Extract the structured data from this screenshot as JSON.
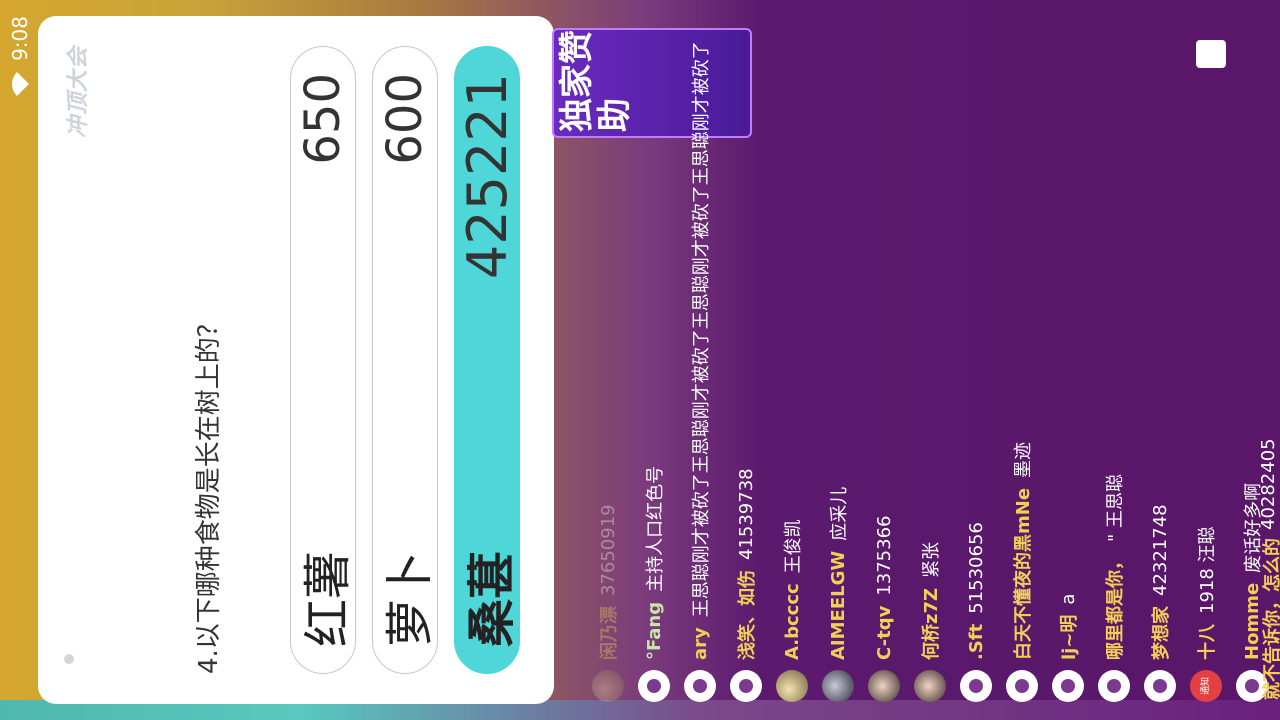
{
  "status": {
    "time": "9:08"
  },
  "card": {
    "logo": "冲顶大会",
    "question": "4.以下哪种食物是长在树上的？",
    "options": [
      {
        "label": "红薯",
        "count": "650"
      },
      {
        "label": "萝卜",
        "count": "600"
      },
      {
        "label": "桑葚",
        "count": "425221"
      }
    ]
  },
  "banner": {
    "text": "独家赞助"
  },
  "chat": [
    {
      "name": "闲乃漂",
      "text": "37650919"
    },
    {
      "name": "°Fang",
      "text": "主持人口红色号"
    },
    {
      "name": "ary",
      "text": "王思聪刚才被砍了王思聪刚才被砍了王思聪刚才被砍了王思聪刚才被砍了"
    },
    {
      "name": "浅笑、如伤",
      "text": "41539738"
    },
    {
      "name": "A.bcccc",
      "text": "王俊凯"
    },
    {
      "name": "AIMEELGW",
      "text": "应采儿"
    },
    {
      "name": "C-tqv",
      "text": "1375366"
    },
    {
      "name": "何桥z7Z",
      "text": "紧张"
    },
    {
      "name": ".Sft",
      "text": "51530656"
    },
    {
      "name": "白天不懂夜的黑mNe",
      "text": "墨迹"
    },
    {
      "name": "lj~明",
      "text": "a"
    },
    {
      "name": "哪里都是你，",
      "text": "\" 王思聪"
    },
    {
      "name": "梦想家",
      "text": "42321748"
    },
    {
      "name": "十八",
      "text": "1918 汪聪"
    },
    {
      "name": "Homme",
      "text": "废话好多啊"
    },
    {
      "name": "就不告诉你，怎么的",
      "text": "40282405"
    }
  ]
}
